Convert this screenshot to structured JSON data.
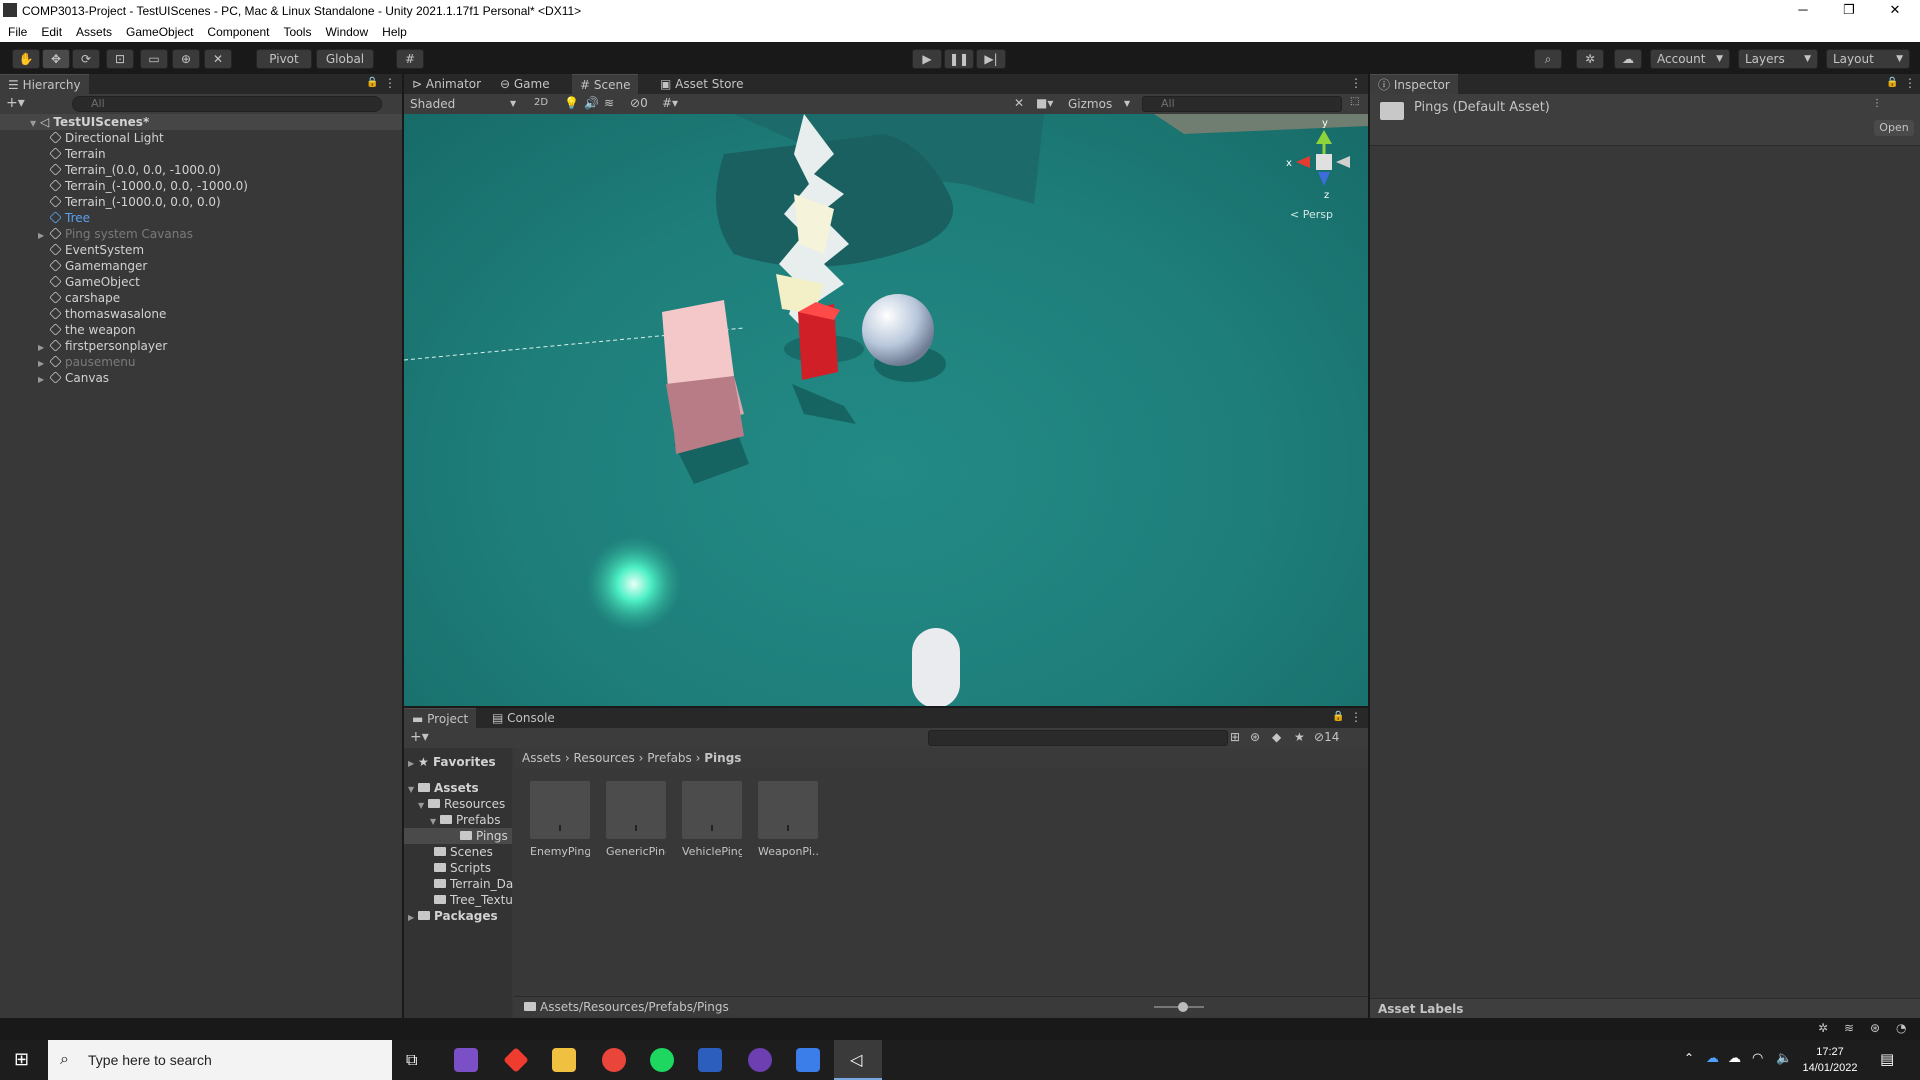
{
  "window": {
    "title": "COMP3013-Project - TestUIScenes - PC, Mac & Linux Standalone - Unity 2021.1.17f1 Personal* <DX11>",
    "controls": [
      "─",
      "❐",
      "✕"
    ]
  },
  "menu": [
    "File",
    "Edit",
    "Assets",
    "GameObject",
    "Component",
    "Tools",
    "Window",
    "Help"
  ],
  "toolbar": {
    "pivot": "Pivot",
    "global": "Global",
    "account": "Account",
    "layers": "Layers",
    "layout": "Layout"
  },
  "hierarchy": {
    "tab": "Hierarchy",
    "search_placeholder": "All",
    "scene": "TestUIScenes*",
    "items": [
      {
        "label": "Directional Light",
        "style": "normal",
        "expand": false
      },
      {
        "label": "Terrain",
        "style": "normal",
        "expand": false
      },
      {
        "label": "Terrain_(0.0, 0.0, -1000.0)",
        "style": "normal",
        "expand": false
      },
      {
        "label": "Terrain_(-1000.0, 0.0, -1000.0)",
        "style": "normal",
        "expand": false
      },
      {
        "label": "Terrain_(-1000.0, 0.0, 0.0)",
        "style": "normal",
        "expand": false
      },
      {
        "label": "Tree",
        "style": "blue",
        "expand": false
      },
      {
        "label": "Ping system Cavanas",
        "style": "grey",
        "expand": true
      },
      {
        "label": "EventSystem",
        "style": "normal",
        "expand": false
      },
      {
        "label": "Gamemanger",
        "style": "normal",
        "expand": false
      },
      {
        "label": "GameObject",
        "style": "normal",
        "expand": false
      },
      {
        "label": "carshape",
        "style": "normal",
        "expand": false
      },
      {
        "label": "thomaswasalone",
        "style": "normal",
        "expand": false
      },
      {
        "label": "the weapon",
        "style": "normal",
        "expand": false
      },
      {
        "label": "firstpersonplayer",
        "style": "normal",
        "expand": true
      },
      {
        "label": "pausemenu",
        "style": "grey",
        "expand": true
      },
      {
        "label": "Canvas",
        "style": "normal",
        "expand": true
      }
    ]
  },
  "scene_tabs": {
    "animator": "Animator",
    "game": "Game",
    "scene": "Scene",
    "asset_store": "Asset Store"
  },
  "scene_toolbar": {
    "shading": "Shaded",
    "mode_2d": "2D",
    "hidden_count": "0",
    "gizmos": "Gizmos",
    "search_placeholder": "All",
    "persp_label": "< Persp",
    "axis_x": "x",
    "axis_y": "y",
    "axis_z": "z"
  },
  "inspector": {
    "tab": "Inspector",
    "asset_name": "Pings (Default Asset)",
    "open_button": "Open",
    "asset_labels": "Asset Labels"
  },
  "project": {
    "tab_project": "Project",
    "tab_console": "Console",
    "hidden_count": "14",
    "favorites": "Favorites",
    "breadcrumb": [
      "Assets",
      "Resources",
      "Prefabs",
      "Pings"
    ],
    "tree": {
      "assets": "Assets",
      "resources": "Resources",
      "prefabs": "Prefabs",
      "pings": "Pings",
      "scenes": "Scenes",
      "scripts": "Scripts",
      "terrain_data": "Terrain_Da",
      "tree_textures": "Tree_Textu",
      "packages": "Packages"
    },
    "assets": [
      "EnemyPing",
      "GenericPing",
      "VehiclePing",
      "WeaponPi..."
    ],
    "footer_path": "Assets/Resources/Prefabs/Pings"
  },
  "taskbar": {
    "search_placeholder": "Type here to search",
    "time": "17:27",
    "date": "14/01/2022"
  }
}
